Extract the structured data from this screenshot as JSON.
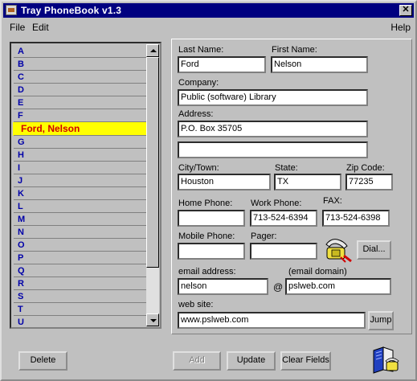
{
  "window": {
    "title": "Tray PhoneBook v1.3",
    "close_label": "✕"
  },
  "menu": {
    "file": "File",
    "edit": "Edit",
    "help": "Help"
  },
  "list": {
    "items": [
      "A",
      "B",
      "C",
      "D",
      "E",
      "F",
      "Ford, Nelson",
      "G",
      "H",
      "I",
      "J",
      "K",
      "L",
      "M",
      "N",
      "O",
      "P",
      "Q",
      "R",
      "S",
      "T",
      "U"
    ],
    "selected_index": 6
  },
  "form": {
    "last_name": {
      "label": "Last Name:",
      "value": "Ford"
    },
    "first_name": {
      "label": "First Name:",
      "value": "Nelson"
    },
    "company": {
      "label": "Company:",
      "value": "Public (software) Library"
    },
    "address": {
      "label": "Address:",
      "line1": "P.O. Box 35705",
      "line2": ""
    },
    "city": {
      "label": "City/Town:",
      "value": "Houston"
    },
    "state": {
      "label": "State:",
      "value": "TX"
    },
    "zip": {
      "label": "Zip Code:",
      "value": "77235"
    },
    "home_phone": {
      "label": "Home Phone:",
      "value": ""
    },
    "work_phone": {
      "label": "Work Phone:",
      "value": "713-524-6394"
    },
    "fax": {
      "label": "FAX:",
      "value": "713-524-6398"
    },
    "mobile_phone": {
      "label": "Mobile Phone:",
      "value": ""
    },
    "pager": {
      "label": "Pager:",
      "value": ""
    },
    "email_address": {
      "label": "email address:",
      "value": "nelson"
    },
    "email_at": "@",
    "email_domain": {
      "label": "(email domain)",
      "value": "pslweb.com"
    },
    "web_site": {
      "label": "web site:",
      "value": "www.pslweb.com"
    }
  },
  "buttons": {
    "dial": "Dial...",
    "jump": "Jump",
    "delete": "Delete",
    "add": "Add",
    "update": "Update",
    "clear": "Clear Fields"
  },
  "icons": {
    "phone": "phone-icon",
    "book": "phonebook-icon"
  }
}
